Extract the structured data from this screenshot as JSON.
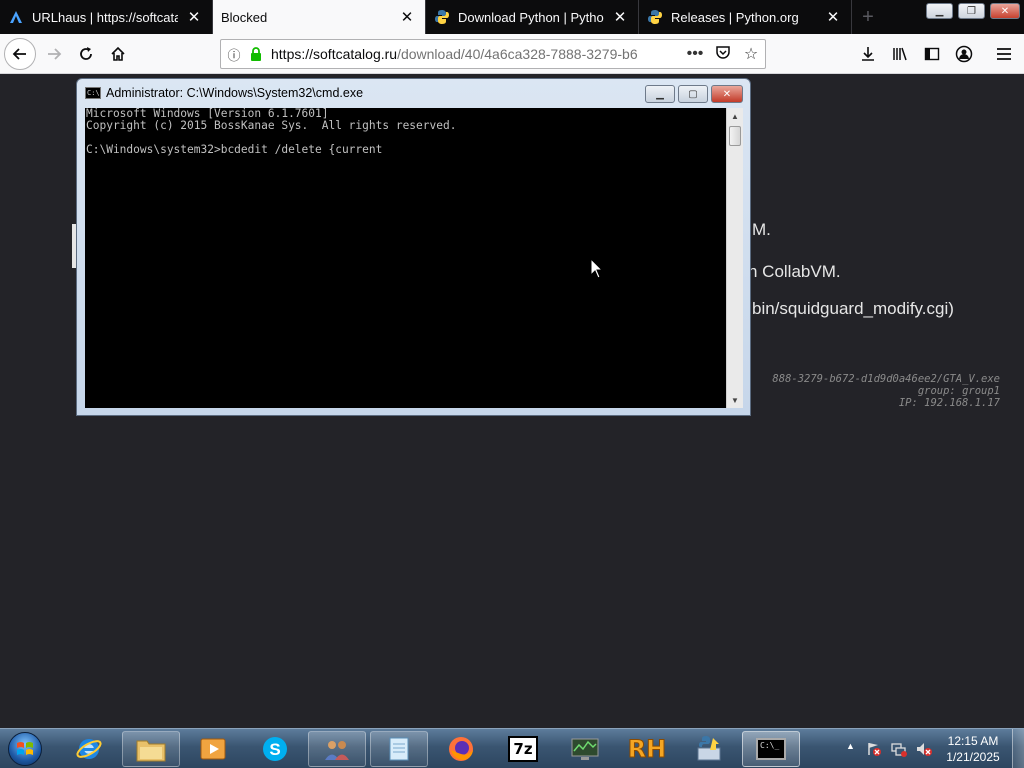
{
  "browser": {
    "tabs": [
      {
        "title": "URLhaus | https://softcatalog.r",
        "icon": "urlhaus-icon"
      },
      {
        "title": "Blocked",
        "icon": "none"
      },
      {
        "title": "Download Python | Python.org",
        "icon": "python-icon"
      },
      {
        "title": "Releases | Python.org",
        "icon": "python-icon"
      }
    ],
    "url_domain": "https://softcatalog.ru",
    "url_path": "/download/40/4a6ca328-7888-3279-b6",
    "page_ellipsis": "•••"
  },
  "page": {
    "line1": "M.",
    "line2": "n CollabVM.",
    "line3": "bin/squidguard_modify.cgi)",
    "mono1": "888-3279-b672-d1d9d0a46ee2/GTA_V.exe",
    "mono2": "group: group1",
    "mono3": "IP: 192.168.1.17"
  },
  "cmd": {
    "title": "Administrator: C:\\Windows\\System32\\cmd.exe",
    "lines": [
      "Microsoft Windows [Version 6.1.7601]",
      "Copyright (c) 2015 BossKanae Sys.  All rights reserved.",
      "",
      "C:\\Windows\\system32>bcdedit /delete {current"
    ]
  },
  "taskbar": {
    "items": [
      {
        "name": "internet-explorer",
        "icon": "ie-icon"
      },
      {
        "name": "windows-explorer",
        "icon": "folder-icon"
      },
      {
        "name": "media-player",
        "icon": "media-icon"
      },
      {
        "name": "skype",
        "icon": "skype-icon"
      },
      {
        "name": "users",
        "icon": "users-icon"
      },
      {
        "name": "notepad",
        "icon": "notepad-icon"
      },
      {
        "name": "firefox",
        "icon": "firefox-icon"
      },
      {
        "name": "7-zip",
        "icon": "7zip-icon"
      },
      {
        "name": "network-monitor",
        "icon": "monitor-icon"
      },
      {
        "name": "resource-hacker",
        "icon": "rh-icon"
      },
      {
        "name": "python-installer",
        "icon": "python-setup-icon"
      },
      {
        "name": "command-prompt",
        "icon": "cmd-icon"
      }
    ],
    "zip_label": "7z",
    "rh_label": "RH",
    "time": "12:15 AM",
    "date": "1/21/2025"
  }
}
